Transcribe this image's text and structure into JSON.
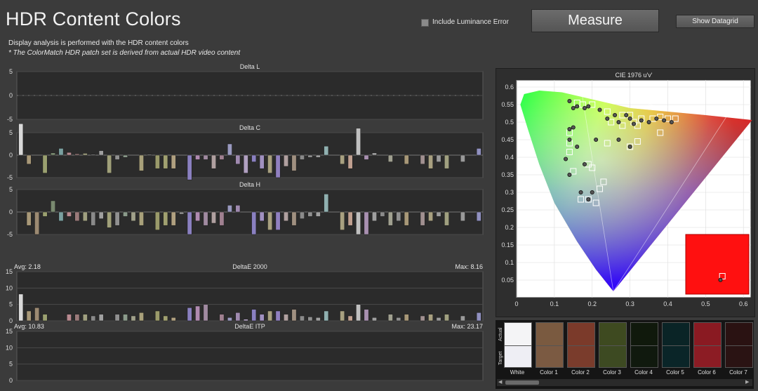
{
  "header": {
    "title": "HDR Content Colors",
    "subtitle": "Display analysis is performed with the HDR content colors",
    "note": "* The ColorMatch HDR patch set is derived from actual HDR video content"
  },
  "toolbar": {
    "include_luminance_label": "Include Luminance Error",
    "include_luminance_checked": false,
    "measure_label": "Measure",
    "datagrid_label": "Show Datagrid"
  },
  "chart_data": [
    {
      "type": "bar",
      "title": "Delta L",
      "ylim": [
        -5,
        5
      ],
      "yticks": [
        "5",
        "0",
        "-5"
      ],
      "values": [
        0,
        0,
        0,
        0,
        0,
        0,
        0,
        0,
        0,
        0,
        0,
        0,
        0,
        0,
        0,
        0,
        0,
        0,
        0,
        0,
        0,
        0,
        0,
        0,
        0,
        0,
        0,
        0,
        0,
        0,
        0,
        0,
        0,
        0,
        0,
        0,
        0,
        0,
        0,
        0,
        0,
        0,
        0,
        0,
        0,
        0,
        0,
        0,
        0,
        0,
        0,
        0,
        0,
        0,
        0,
        0,
        0,
        0
      ]
    },
    {
      "type": "bar",
      "title": "Delta C",
      "ylim": [
        -5,
        5
      ],
      "yticks": [
        "5",
        "0",
        "-5"
      ],
      "values": [
        7,
        -2,
        0,
        -4,
        0.5,
        1.5,
        0.6,
        0.3,
        0.4,
        0.2,
        1,
        -4,
        -1,
        -0.5,
        0,
        -3.5,
        0.2,
        -3,
        -3,
        -3,
        0,
        -5.5,
        -1,
        -1,
        -3,
        -1,
        2.5,
        -2,
        -4,
        -1.5,
        -3,
        -4,
        -5,
        -2.5,
        -3.5,
        -1,
        -0.5,
        -0.5,
        2,
        0,
        -2,
        -3,
        6,
        -1,
        0.5,
        0,
        -1.5,
        0,
        -2,
        0,
        -2,
        -3,
        -1.5,
        -3,
        0,
        -1.5,
        0,
        1.5
      ]
    },
    {
      "type": "bar",
      "title": "Delta H",
      "ylim": [
        -5,
        5
      ],
      "yticks": [
        "5",
        "0",
        "-5"
      ],
      "values": [
        0,
        -3,
        -5,
        -1,
        2.5,
        -2,
        -1,
        -2,
        -2,
        -3,
        -1.5,
        -3.5,
        -3,
        -1,
        -2,
        -3,
        0,
        -4,
        -3,
        -3,
        -0.5,
        -5,
        -2,
        -3,
        -2.5,
        -3,
        1.5,
        1.5,
        0,
        -5,
        -2,
        -4,
        -4,
        -2,
        -3,
        -1.5,
        -1,
        -1,
        4,
        0,
        -4,
        -3,
        -5,
        -5,
        -2,
        -1,
        -3,
        -2,
        -3,
        0,
        -3,
        -2,
        -1,
        -3,
        0,
        -2,
        0,
        -2
      ]
    },
    {
      "type": "bar",
      "title": "DeltaE 2000",
      "ylim": [
        0,
        15
      ],
      "yticks": [
        "15",
        "10",
        "5",
        "0"
      ],
      "avg_label": "Avg: 2.18",
      "max_label": "Max: 8.16",
      "values": [
        8.16,
        3,
        4,
        2,
        0,
        0,
        2,
        2,
        2,
        1.5,
        2,
        0,
        2,
        2,
        1.5,
        2.5,
        0,
        3,
        1.5,
        1,
        0,
        4,
        4.5,
        5,
        0,
        2,
        1,
        2.5,
        0.5,
        3.5,
        2,
        3,
        3,
        2,
        3.5,
        1.5,
        1.2,
        1,
        3,
        0,
        3,
        1.5,
        5,
        3.5,
        1,
        0,
        2,
        1,
        2,
        0,
        1.5,
        2,
        1,
        2,
        0,
        1.5,
        0,
        2.5
      ]
    },
    {
      "type": "bar",
      "title": "DeltaE ITP",
      "ylim": [
        0,
        15
      ],
      "yticks": [
        "15",
        "10",
        "5",
        "0"
      ],
      "avg_label": "Avg: 10.83",
      "max_label": "Max: 23.17",
      "values": []
    },
    {
      "type": "scatter",
      "title": "CIE 1976 u'v'",
      "xlim": [
        0,
        0.62
      ],
      "ylim": [
        0,
        0.62
      ],
      "xticks": [
        "0",
        "0.1",
        "0.2",
        "0.3",
        "0.4",
        "0.5",
        "0.6"
      ],
      "yticks": [
        "0.6",
        "0.55",
        "0.5",
        "0.45",
        "0.4",
        "0.35",
        "0.3",
        "0.25",
        "0.2",
        "0.15",
        "0.1",
        "0.05"
      ],
      "gamut": [
        [
          0.556,
          0.517
        ],
        [
          0.173,
          0.58
        ],
        [
          0.256,
          0.018
        ]
      ],
      "white_point": [
        0.198,
        0.468
      ],
      "targets": [
        [
          0.16,
          0.555
        ],
        [
          0.175,
          0.55
        ],
        [
          0.2,
          0.55
        ],
        [
          0.24,
          0.53
        ],
        [
          0.28,
          0.52
        ],
        [
          0.31,
          0.5
        ],
        [
          0.3,
          0.52
        ],
        [
          0.33,
          0.51
        ],
        [
          0.36,
          0.51
        ],
        [
          0.38,
          0.515
        ],
        [
          0.4,
          0.51
        ],
        [
          0.42,
          0.51
        ],
        [
          0.25,
          0.5
        ],
        [
          0.28,
          0.49
        ],
        [
          0.32,
          0.49
        ],
        [
          0.14,
          0.47
        ],
        [
          0.14,
          0.44
        ],
        [
          0.14,
          0.415
        ],
        [
          0.24,
          0.44
        ],
        [
          0.3,
          0.43
        ],
        [
          0.32,
          0.445
        ],
        [
          0.38,
          0.47
        ],
        [
          0.15,
          0.36
        ],
        [
          0.19,
          0.38
        ],
        [
          0.2,
          0.37
        ],
        [
          0.23,
          0.33
        ],
        [
          0.22,
          0.31
        ],
        [
          0.17,
          0.28
        ],
        [
          0.19,
          0.28
        ],
        [
          0.21,
          0.27
        ]
      ],
      "actuals": [
        [
          0.14,
          0.56
        ],
        [
          0.15,
          0.54
        ],
        [
          0.16,
          0.545
        ],
        [
          0.18,
          0.54
        ],
        [
          0.19,
          0.545
        ],
        [
          0.22,
          0.535
        ],
        [
          0.26,
          0.52
        ],
        [
          0.29,
          0.52
        ],
        [
          0.3,
          0.51
        ],
        [
          0.33,
          0.505
        ],
        [
          0.35,
          0.5
        ],
        [
          0.37,
          0.51
        ],
        [
          0.39,
          0.505
        ],
        [
          0.41,
          0.5
        ],
        [
          0.24,
          0.51
        ],
        [
          0.27,
          0.5
        ],
        [
          0.31,
          0.495
        ],
        [
          0.14,
          0.48
        ],
        [
          0.15,
          0.485
        ],
        [
          0.14,
          0.45
        ],
        [
          0.16,
          0.43
        ],
        [
          0.13,
          0.395
        ],
        [
          0.21,
          0.45
        ],
        [
          0.27,
          0.45
        ],
        [
          0.3,
          0.43
        ],
        [
          0.14,
          0.35
        ],
        [
          0.18,
          0.38
        ],
        [
          0.17,
          0.3
        ],
        [
          0.19,
          0.28
        ],
        [
          0.2,
          0.3
        ]
      ]
    }
  ],
  "zoom_inset": {
    "target": [
      0.58,
      0.3
    ],
    "actual": [
      0.55,
      0.22
    ]
  },
  "swatches": {
    "actual_label": "Actual",
    "target_label": "Target",
    "items": [
      {
        "label": "White",
        "actual": "#f4f4f6",
        "target": "#eeeef4"
      },
      {
        "label": "Color 1",
        "actual": "#7a5a40",
        "target": "#7b5a42"
      },
      {
        "label": "Color 2",
        "actual": "#7b3a2a",
        "target": "#7a3c2c"
      },
      {
        "label": "Color 3",
        "actual": "#3e4a20",
        "target": "#3d4a22"
      },
      {
        "label": "Color 4",
        "actual": "#10190c",
        "target": "#10190e"
      },
      {
        "label": "Color 5",
        "actual": "#0a2426",
        "target": "#0a2528"
      },
      {
        "label": "Color 6",
        "actual": "#8a1a22",
        "target": "#8c1c24"
      },
      {
        "label": "Color 7",
        "actual": "#2a1212",
        "target": "#2a1313"
      }
    ]
  }
}
